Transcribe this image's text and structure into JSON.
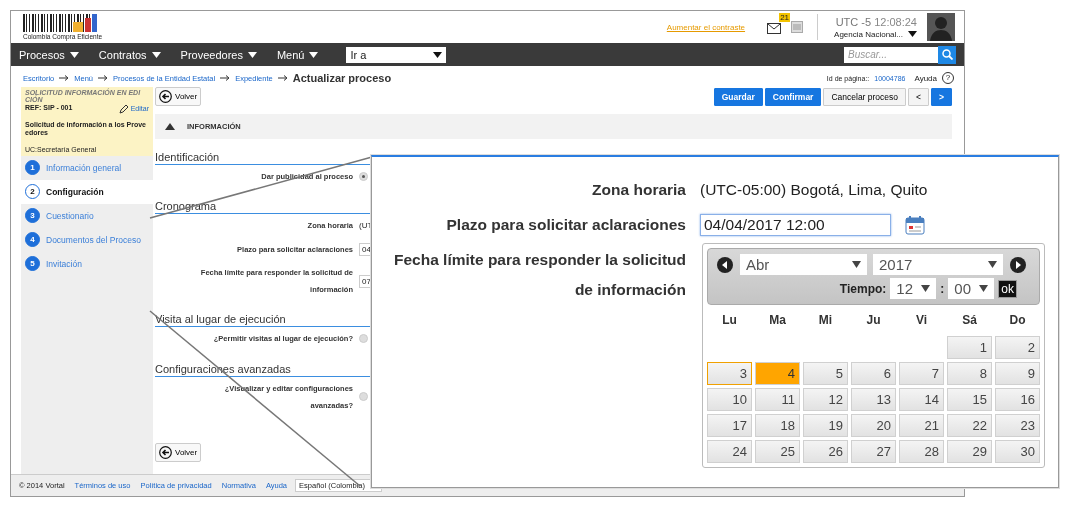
{
  "header": {
    "logo_text": "Colombia Compra Eficiente",
    "contrast_link": "Aumentar el contraste",
    "mail_badge": "21",
    "timezone": "UTC -5",
    "time": "12:08:24",
    "agency": "Agencia Nacional..."
  },
  "navbar": {
    "menus": [
      "Procesos",
      "Contratos",
      "Proveedores",
      "Menú"
    ],
    "goto": "Ir a",
    "search_placeholder": "Buscar..."
  },
  "breadcrumb": {
    "items": [
      "Escritorio",
      "Menú",
      "Procesos de la Entidad Estatal",
      "Expediente"
    ],
    "current": "Actualizar proceso",
    "page_id_label": "Id de página::",
    "page_id": "10004786",
    "help": "Ayuda",
    "help_icon": "?"
  },
  "process_card": {
    "status": "SOLICITUD INFORMACIÓN EN EDICIÓN",
    "ref": "REF: SIP - 001",
    "edit": "Editar",
    "name": "Solicitud de información a los Proveedores",
    "unit": "UC:Secretaría General"
  },
  "steps": [
    {
      "number": "1",
      "label": "Información general",
      "selected": false
    },
    {
      "number": "2",
      "label": "Configuración",
      "selected": true
    },
    {
      "number": "3",
      "label": "Cuestionario",
      "selected": false
    },
    {
      "number": "4",
      "label": "Documentos del Proceso",
      "selected": false
    },
    {
      "number": "5",
      "label": "Invitación",
      "selected": false
    }
  ],
  "toolbar": {
    "back": "Volver",
    "actions": [
      {
        "label": "Guardar",
        "kind": "primary"
      },
      {
        "label": "Confirmar",
        "kind": "primary"
      },
      {
        "label": "Cancelar proceso",
        "kind": "default"
      },
      {
        "label": "<",
        "kind": "default"
      },
      {
        "label": ">",
        "kind": "primary"
      }
    ]
  },
  "panel": {
    "title": "INFORMACIÓN",
    "expanded": true
  },
  "sections": [
    {
      "title": "Identificación",
      "fields": [
        {
          "label": "Dar publicidad al proceso",
          "kind": "radio",
          "checked": true
        }
      ]
    },
    {
      "title": "Cronograma",
      "fields": [
        {
          "label": "Zona horaria",
          "kind": "text",
          "value": "(UT"
        },
        {
          "label": "Plazo para solicitar aclaraciones",
          "kind": "input",
          "value": "04"
        },
        {
          "label": "Fecha límite para responder la solicitud de información",
          "kind": "input",
          "value": "07"
        }
      ]
    },
    {
      "title": "Visita al lugar de ejecución",
      "fields": [
        {
          "label": "¿Permitir visitas al lugar de ejecución?",
          "kind": "radio",
          "checked": false
        }
      ]
    },
    {
      "title": "Configuraciones avanzadas",
      "fields": [
        {
          "label": "¿Visualizar y editar configuraciones avanzadas?",
          "kind": "radio",
          "checked": false
        }
      ]
    }
  ],
  "bottom_back": "Volver",
  "footer": {
    "copyright": "© 2014 Vortal",
    "links": [
      "Términos de uso",
      "Política de privacidad",
      "Normativa",
      "Ayuda"
    ],
    "language": "Español (Colombia)"
  },
  "zoom": {
    "fields": [
      {
        "label": "Zona horaria",
        "kind": "text",
        "value": "(UTC-05:00) Bogotá, Lima, Quito"
      },
      {
        "label": "Plazo para solicitar aclaraciones",
        "kind": "date",
        "value": "04/04/2017 12:00"
      },
      {
        "label": "Fecha límite para responder la solicitud de información",
        "kind": "empty"
      }
    ],
    "datepicker": {
      "month": "Abr",
      "year": "2017",
      "time_label": "Tiempo:",
      "hour": "12",
      "separator": ":",
      "minute": "00",
      "ok": "ok",
      "weekdays": [
        "Lu",
        "Ma",
        "Mi",
        "Ju",
        "Vi",
        "Sá",
        "Do"
      ],
      "weeks": [
        [
          {
            "kind": "empty"
          },
          {
            "kind": "empty"
          },
          {
            "kind": "empty"
          },
          {
            "kind": "empty"
          },
          {
            "kind": "empty"
          },
          {
            "day": "1",
            "selected": false,
            "today": false
          },
          {
            "day": "2",
            "selected": false,
            "today": false
          }
        ],
        [
          {
            "day": "3",
            "selected": false,
            "today": true
          },
          {
            "day": "4",
            "selected": true,
            "today": false
          },
          {
            "day": "5",
            "selected": false,
            "today": false
          },
          {
            "day": "6",
            "selected": false,
            "today": false
          },
          {
            "day": "7",
            "selected": false,
            "today": false
          },
          {
            "day": "8",
            "selected": false,
            "today": false
          },
          {
            "day": "9",
            "selected": false,
            "today": false
          }
        ],
        [
          {
            "day": "10",
            "selected": false,
            "today": false
          },
          {
            "day": "11",
            "selected": false,
            "today": false
          },
          {
            "day": "12",
            "selected": false,
            "today": false
          },
          {
            "day": "13",
            "selected": false,
            "today": false
          },
          {
            "day": "14",
            "selected": false,
            "today": false
          },
          {
            "day": "15",
            "selected": false,
            "today": false
          },
          {
            "day": "16",
            "selected": false,
            "today": false
          }
        ],
        [
          {
            "day": "17",
            "selected": false,
            "today": false
          },
          {
            "day": "18",
            "selected": false,
            "today": false
          },
          {
            "day": "19",
            "selected": false,
            "today": false
          },
          {
            "day": "20",
            "selected": false,
            "today": false
          },
          {
            "day": "21",
            "selected": false,
            "today": false
          },
          {
            "day": "22",
            "selected": false,
            "today": false
          },
          {
            "day": "23",
            "selected": false,
            "today": false
          }
        ],
        [
          {
            "day": "24",
            "selected": false,
            "today": false
          },
          {
            "day": "25",
            "selected": false,
            "today": false
          },
          {
            "day": "26",
            "selected": false,
            "today": false
          },
          {
            "day": "27",
            "selected": false,
            "today": false
          },
          {
            "day": "28",
            "selected": false,
            "today": false
          },
          {
            "day": "29",
            "selected": false,
            "today": false
          },
          {
            "day": "30",
            "selected": false,
            "today": false
          }
        ]
      ]
    }
  }
}
